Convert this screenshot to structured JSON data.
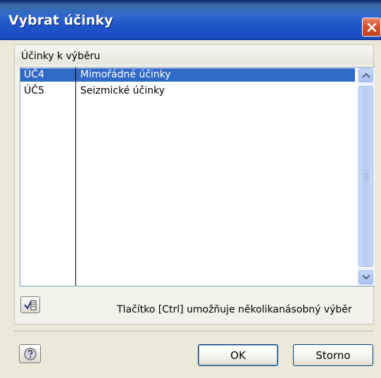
{
  "window": {
    "title": "Vybrat účinky"
  },
  "group": {
    "label": "Účinky k výběru"
  },
  "list": {
    "rows": [
      {
        "id": "ÚČ4",
        "name": "Mimořádné účinky",
        "selected": true
      },
      {
        "id": "ÚČ5",
        "name": "Seizmické účinky",
        "selected": false
      }
    ]
  },
  "hint": "Tlačítko [Ctrl] umožňuje několikanásobný výběr",
  "buttons": {
    "ok": "OK",
    "storno": "Storno"
  },
  "icons": {
    "close": "close-icon",
    "multi_select": "multi-select-icon",
    "help": "help-icon",
    "scroll_up": "chevron-up-icon",
    "scroll_down": "chevron-down-icon"
  },
  "colors": {
    "selection": "#3169c6",
    "titlebar": "#1e53c7",
    "close": "#d9552e"
  }
}
